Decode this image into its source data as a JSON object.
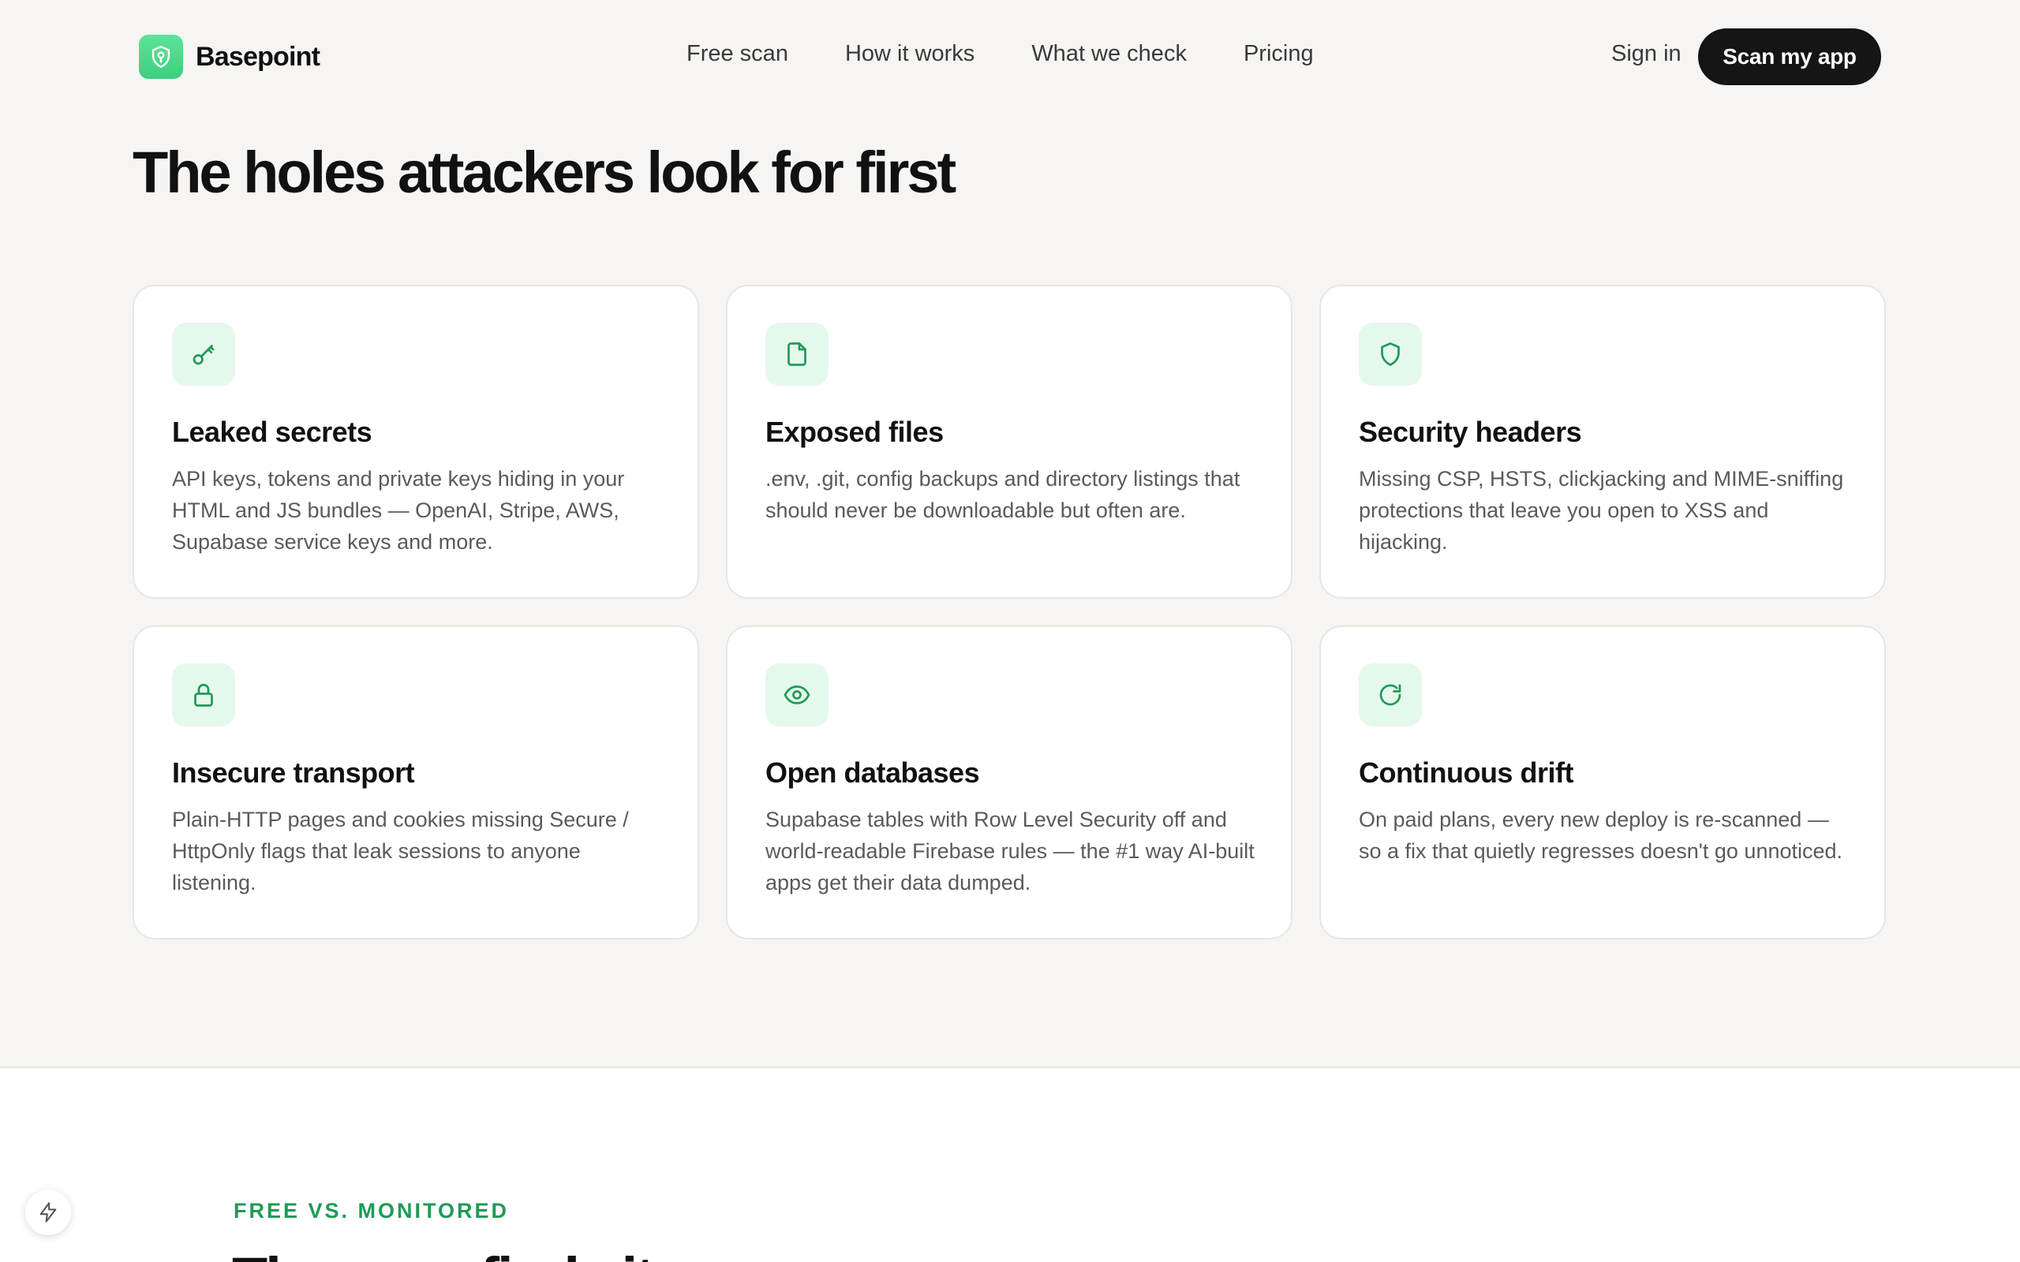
{
  "brand": {
    "name": "Basepoint"
  },
  "nav": {
    "items": [
      {
        "label": "Free scan"
      },
      {
        "label": "How it works"
      },
      {
        "label": "What we check"
      },
      {
        "label": "Pricing"
      }
    ],
    "sign_in": "Sign in",
    "cta": "Scan my app"
  },
  "section": {
    "title": "The holes attackers look for first"
  },
  "cards": [
    {
      "icon": "key-icon",
      "title": "Leaked secrets",
      "desc": "API keys, tokens and private keys hiding in your HTML and JS bundles — OpenAI, Stripe, AWS, Supabase service keys and more."
    },
    {
      "icon": "file-icon",
      "title": "Exposed files",
      "desc": ".env, .git, config backups and directory listings that should never be downloadable but often are."
    },
    {
      "icon": "shield-icon",
      "title": "Security headers",
      "desc": "Missing CSP, HSTS, clickjacking and MIME-sniffing protections that leave you open to XSS and hijacking."
    },
    {
      "icon": "lock-icon",
      "title": "Insecure transport",
      "desc": "Plain-HTTP pages and cookies missing Secure / HttpOnly flags that leak sessions to anyone listening."
    },
    {
      "icon": "eye-icon",
      "title": "Open databases",
      "desc": "Supabase tables with Row Level Security off and world-readable Firebase rules — the #1 way AI-built apps get their data dumped."
    },
    {
      "icon": "refresh-icon",
      "title": "Continuous drift",
      "desc": "On paid plans, every new deploy is re-scanned — so a fix that quietly regresses doesn't go unnoticed."
    }
  ],
  "lower": {
    "eyebrow": "FREE VS. MONITORED",
    "title": "The scan finds it"
  },
  "colors": {
    "accent": "#1f9a57",
    "icon_bg": "#e5f8ec",
    "cta_bg": "#151515",
    "page_bg": "#f6f5f3"
  }
}
